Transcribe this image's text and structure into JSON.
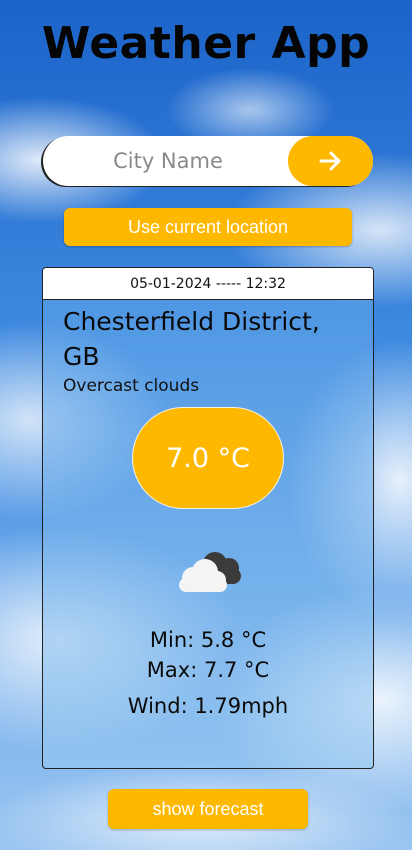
{
  "app": {
    "title": "Weather App"
  },
  "search": {
    "placeholder": "City Name",
    "value": "",
    "submit_icon": "arrow-right-icon"
  },
  "location_button": {
    "label": "Use current location"
  },
  "card": {
    "datetime": "05-01-2024 ----- 12:32",
    "city": "Chesterfield District, GB",
    "description": "Overcast clouds",
    "temperature": "7.0 °C",
    "icon": "overcast-clouds-icon",
    "min": "Min: 5.8 °C",
    "max": "Max: 7.7 °C",
    "wind": "Wind: 1.79mph"
  },
  "forecast_button": {
    "label": "show forecast"
  },
  "colors": {
    "accent": "#ffb800",
    "text": "#0a0a0a",
    "button_text": "#ffffff"
  }
}
